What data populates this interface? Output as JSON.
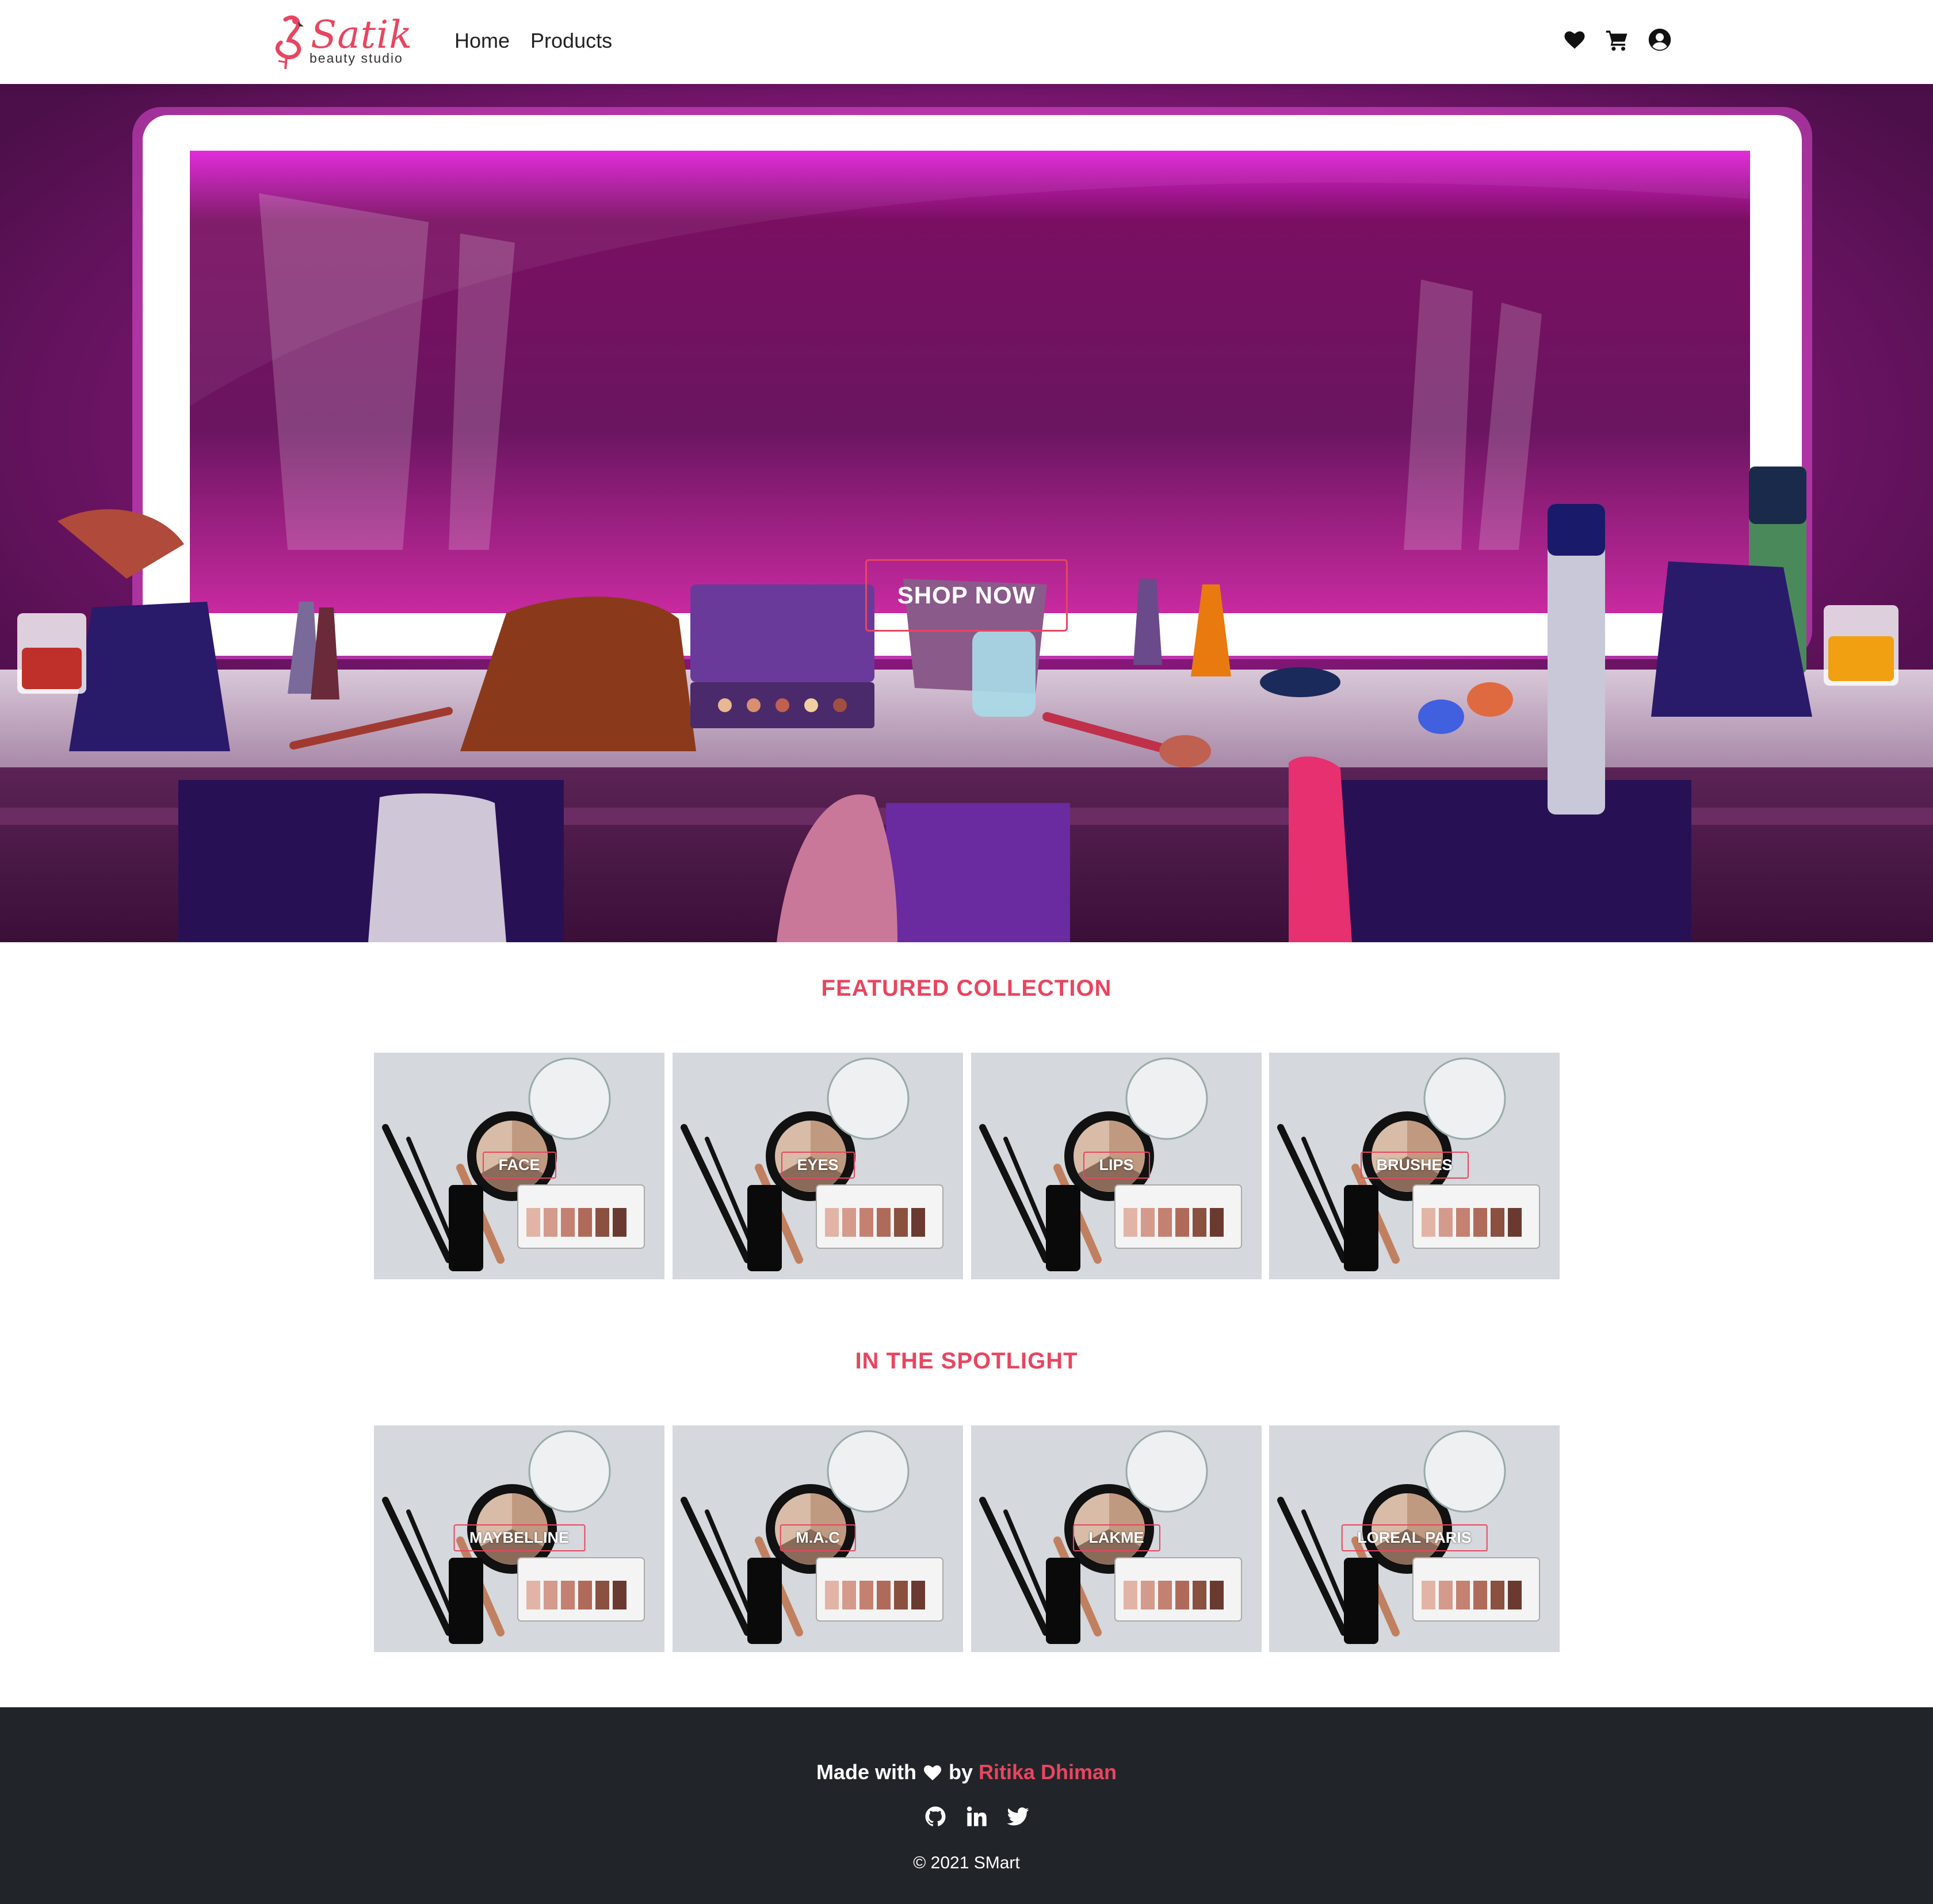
{
  "brand": {
    "name": "Satik",
    "tagline": "beauty studio"
  },
  "nav": {
    "links": [
      "Home",
      "Products"
    ],
    "icons": [
      "heart-icon",
      "cart-icon",
      "user-circle-icon"
    ]
  },
  "hero": {
    "cta": "SHOP NOW"
  },
  "featured": {
    "title": "FEATURED COLLECTION",
    "items": [
      "FACE",
      "EYES",
      "LIPS",
      "BRUSHES"
    ]
  },
  "spotlight": {
    "title": "IN THE SPOTLIGHT",
    "items": [
      "MAYBELLINE",
      "M.A.C",
      "LAKME",
      "LOREAL PARIS"
    ]
  },
  "footer": {
    "made_prefix": "Made with",
    "made_by": "by",
    "author": "Ritika Dhiman",
    "socials": [
      "github-icon",
      "linkedin-icon",
      "twitter-icon"
    ],
    "copyright": "© 2021 SMart"
  },
  "colors": {
    "accent": "#e94560",
    "footer_bg": "#212529",
    "hero_bg": "#5a1656"
  }
}
